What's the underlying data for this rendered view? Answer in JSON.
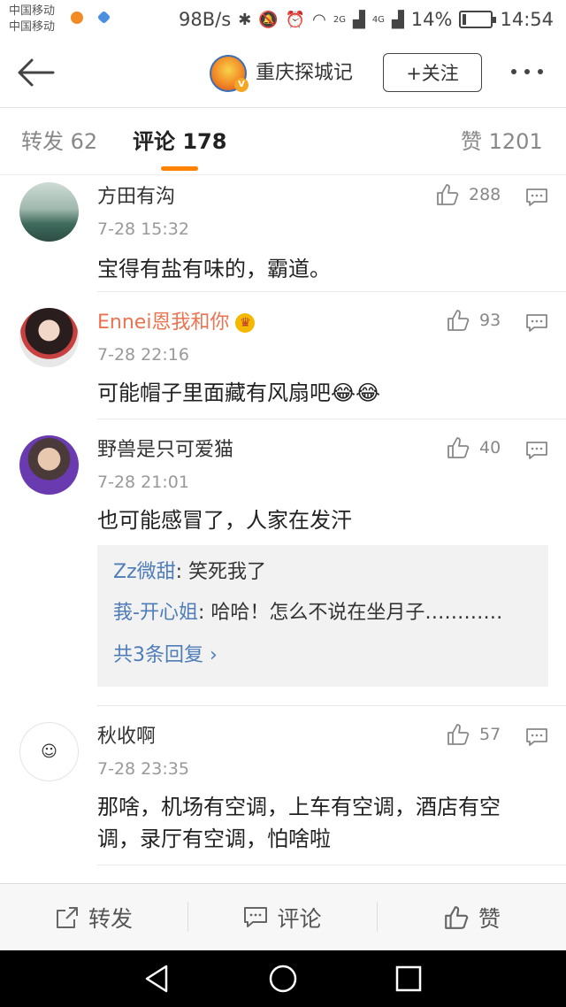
{
  "status_bar": {
    "carrier_1": "中国移动",
    "carrier_2": "中国移动",
    "speed": "98B/s",
    "signal_1": "2G",
    "signal_2": "4G",
    "battery": "14%",
    "battery_level": 0.14,
    "time": "14:54"
  },
  "header": {
    "account_name": "重庆探城记",
    "follow_label": "+关注"
  },
  "tabs": [
    {
      "label": "转发 62",
      "active": false
    },
    {
      "label": "评论 178",
      "active": true
    },
    {
      "label": "赞 1201",
      "active": false
    }
  ],
  "comments": [
    {
      "name": "方田有沟",
      "time": "7-28 15:32",
      "likes": "288",
      "text": "宝得有盐有味的，霸道。"
    },
    {
      "name": "Ennei恩我和你",
      "time": "7-28 22:16",
      "likes": "93",
      "text": "可能帽子里面藏有风扇吧😂😂"
    },
    {
      "name": "野兽是只可爱猫",
      "time": "7-28 21:01",
      "likes": "40",
      "text": "也可能感冒了，人家在发汗",
      "replies": [
        {
          "who": "Zz微甜",
          "text": ": 笑死我了"
        },
        {
          "who": "莪-开心姐",
          "text": ": 哈哈！怎么不说在坐月子…………"
        }
      ],
      "more_replies": "共3条回复 ›"
    },
    {
      "name": "秋收啊",
      "time": "7-28 23:35",
      "likes": "57",
      "text": "那啥，机场有空调，上车有空调，酒店有空调，录厅有空调，怕啥啦"
    }
  ],
  "actions": {
    "repost": "转发",
    "comment": "评论",
    "like": "赞"
  },
  "colors": {
    "accent": "#ff8200",
    "link": "#4f7db8",
    "vip_name": "#eb7350"
  }
}
